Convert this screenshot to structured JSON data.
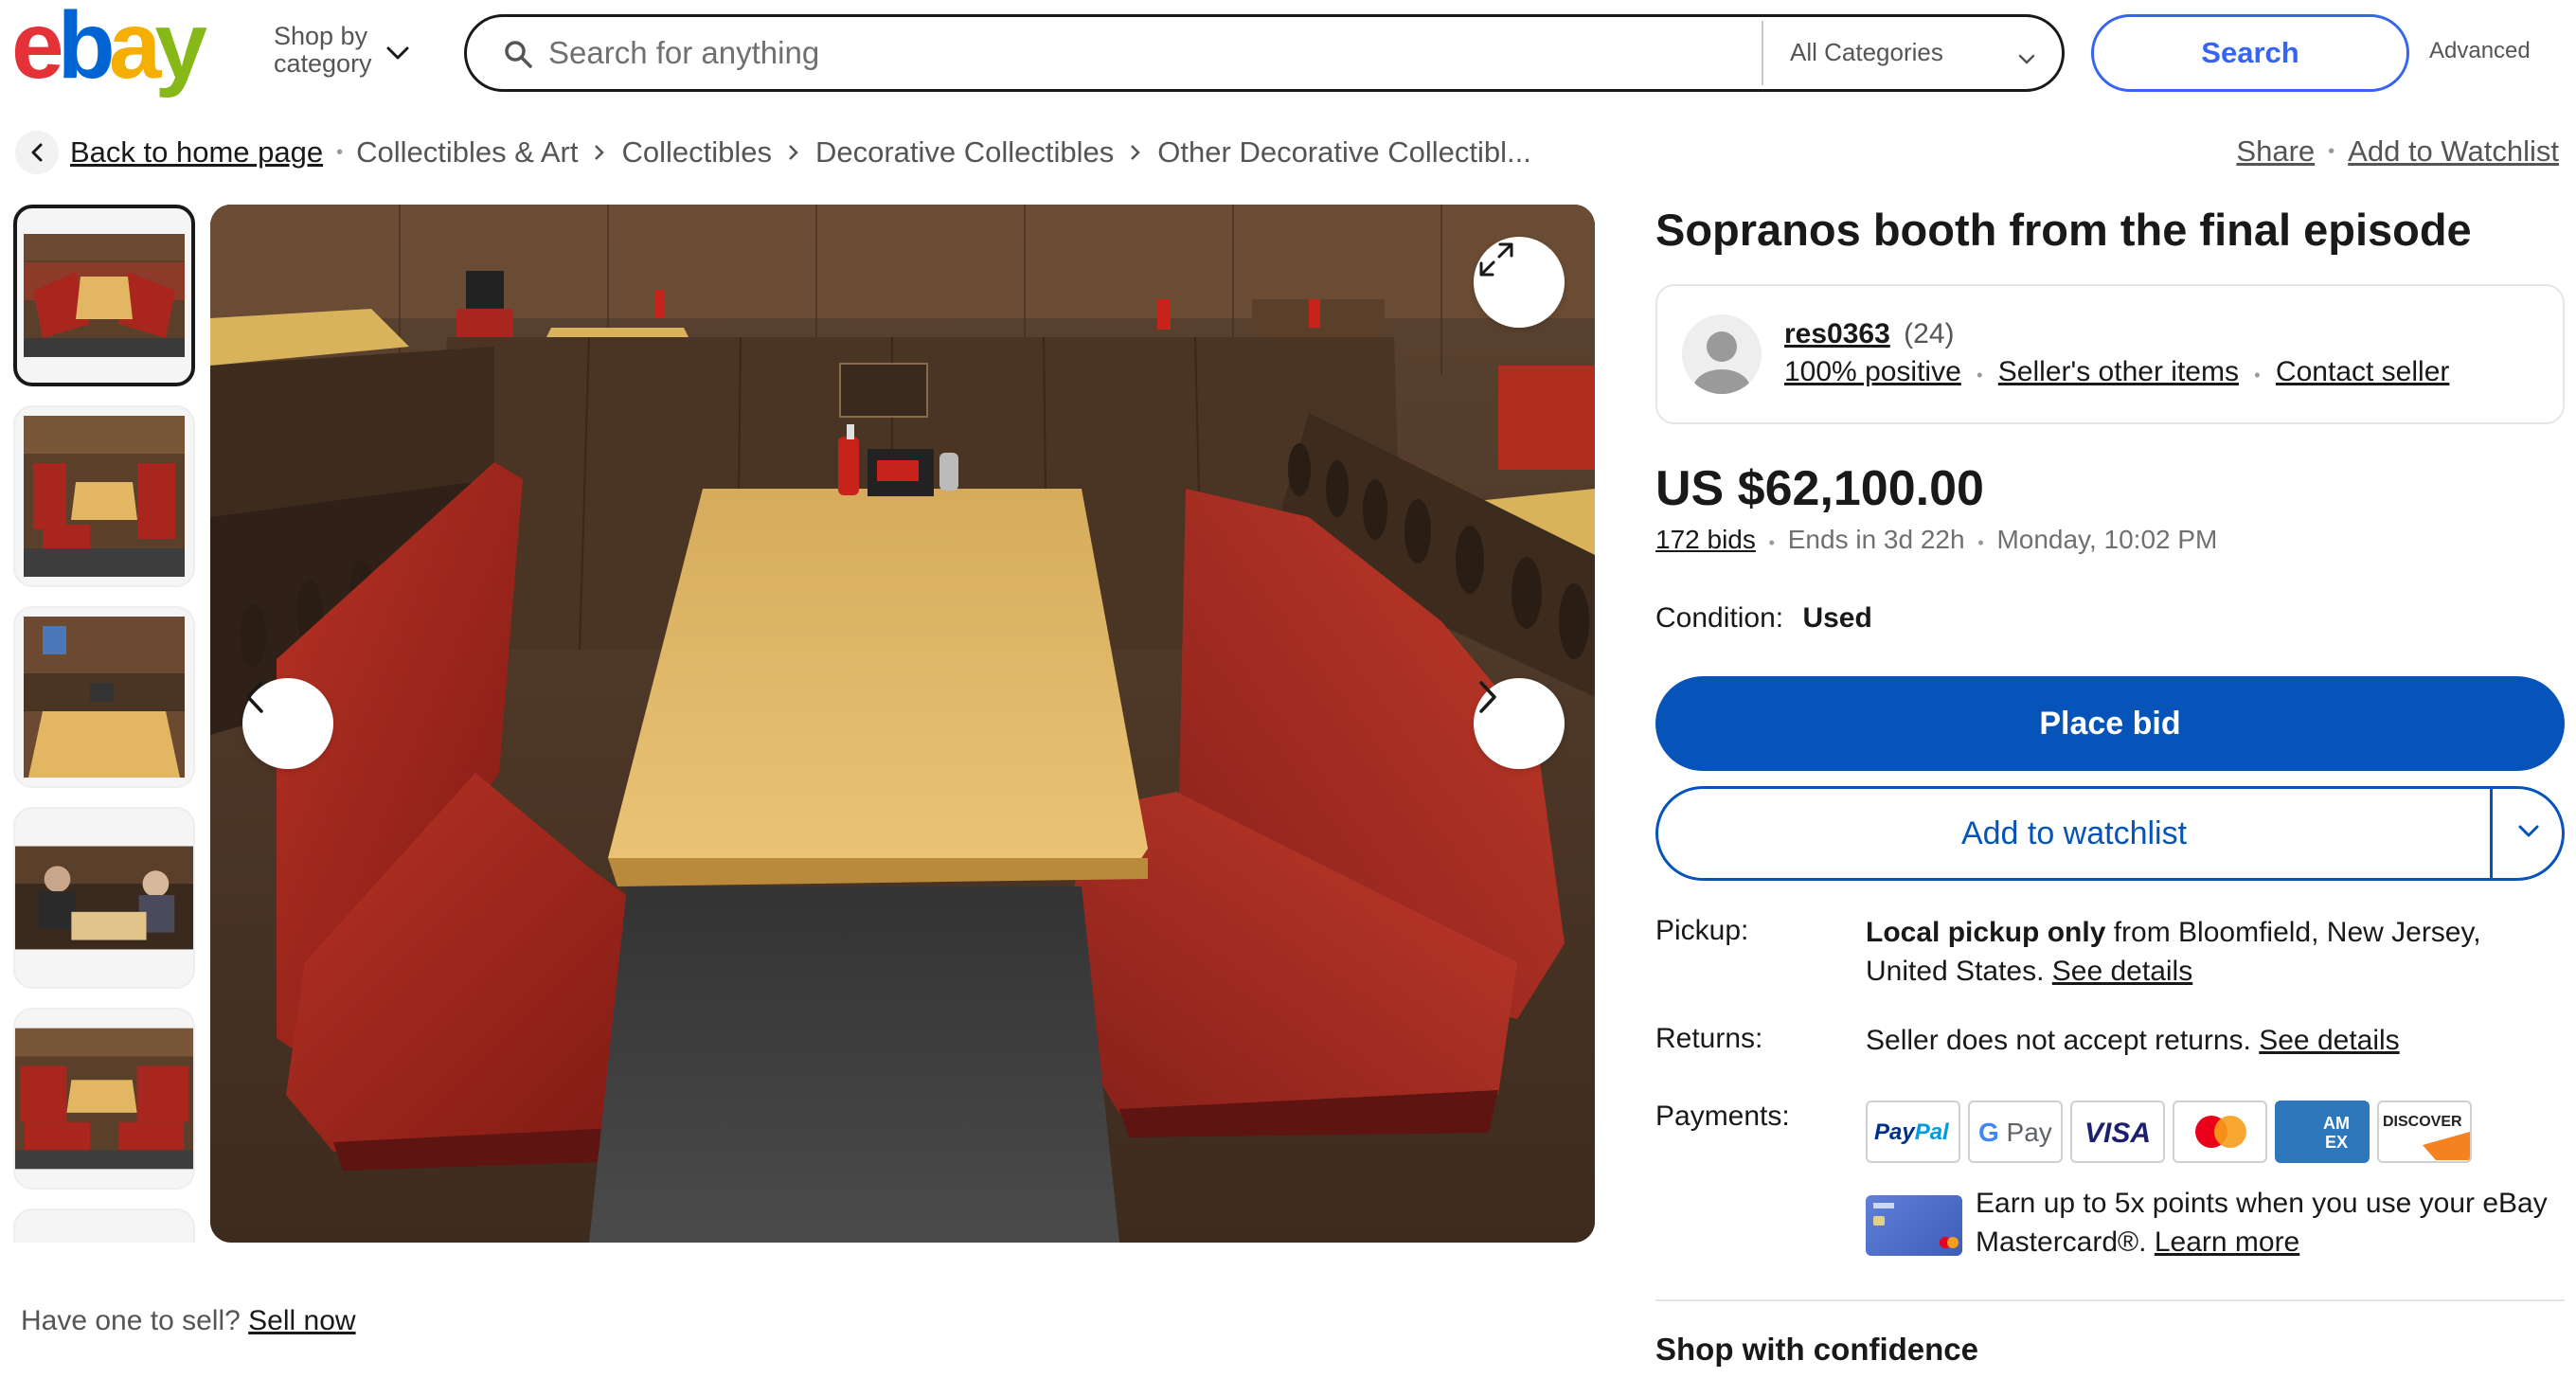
{
  "header": {
    "logo_text": "ebay",
    "shop_by_category": "Shop by category",
    "search_placeholder": "Search for anything",
    "category_select": "All Categories",
    "search_button": "Search",
    "advanced_link": "Advanced",
    "logo_colors": [
      "#e53238",
      "#0064d2",
      "#f5af02",
      "#86b817"
    ]
  },
  "breadcrumb": {
    "back_label": "Back to home page",
    "items": [
      "Collectibles & Art",
      "Collectibles",
      "Decorative Collectibles",
      "Other Decorative Collectibl..."
    ]
  },
  "actions": {
    "share": "Share",
    "add_to_watchlist": "Add to Watchlist"
  },
  "gallery": {
    "thumbnail_count_visible": 6,
    "selected_index": 0,
    "main_image": "red-leather-diner-booth-photo"
  },
  "sell": {
    "prompt": "Have one to sell?",
    "link": "Sell now"
  },
  "listing": {
    "title": "Sopranos booth from the final episode",
    "seller": {
      "name": "res0363",
      "feedback_count": "(24)",
      "positive": "100% positive",
      "other_items": "Seller's other items",
      "contact": "Contact seller"
    },
    "price": "US $62,100.00",
    "bids": "172 bids",
    "ends_in": "Ends in 3d 22h",
    "end_time": "Monday, 10:02 PM",
    "condition_label": "Condition:",
    "condition_value": "Used",
    "place_bid": "Place bid",
    "add_watchlist": "Add to watchlist",
    "pickup": {
      "label": "Pickup:",
      "bold": "Local pickup only",
      "text": " from Bloomfield, New Jersey, United States. ",
      "link": "See details"
    },
    "returns": {
      "label": "Returns:",
      "text": "Seller does not accept returns. ",
      "link": "See details"
    },
    "payments": {
      "label": "Payments:",
      "methods": [
        "PayPal",
        "G Pay",
        "VISA",
        "mastercard-logo",
        "AM EX",
        "DISCOVER"
      ]
    },
    "earn": {
      "text": "Earn up to 5x points when you use your eBay Mastercard®. ",
      "link": "Learn more"
    },
    "shop_confidence": "Shop with confidence"
  },
  "colors": {
    "primary_blue": "#0654ba",
    "search_blue": "#3665f3",
    "booth_red": "#a9261e",
    "table_yellow": "#e2b662",
    "wood_brown": "#4a3424"
  }
}
